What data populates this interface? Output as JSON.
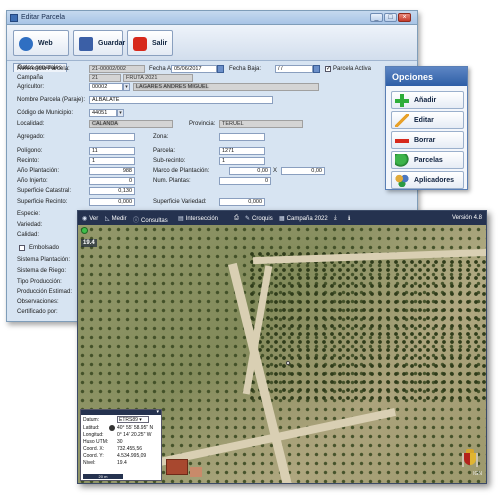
{
  "window": {
    "title": "Editar Parcela",
    "min": "_",
    "max": "□",
    "close": "×"
  },
  "toolbar": {
    "web": "Web",
    "guardar": "Guardar",
    "salir": "Salir"
  },
  "tab": "Datos generales",
  "form": {
    "referencia_label": "Referencia Parcela:",
    "referencia": "21-00002/002",
    "fecha_alta_label": "Fecha Alta:",
    "fecha_alta": "05/06/2017",
    "fecha_baja_label": "Fecha Baja:",
    "fecha_baja": " / /",
    "activa_label": "Parcela Activa",
    "activa_check": "✓",
    "campana_label": "Campaña",
    "campana_num": "21",
    "campana_name": "FRUTA 2021",
    "agricultor_label": "Agricultor:",
    "agricultor_code": "00002",
    "agricultor_name": "LAGARES ANDRES MIGUEL",
    "nombre_label": "Nombre Parcela (Paraje):",
    "nombre": "ALBALATE",
    "municipio_label": "Código de Municipio:",
    "municipio": "44051",
    "localidad_label": "Localidad:",
    "localidad": "CALANDA",
    "provincia_label": "Provincia:",
    "provincia": "TERUEL",
    "agregado_label": "Agregado:",
    "agregado": "",
    "zona_label": "Zona:",
    "zona": "",
    "poligono_label": "Polígono:",
    "poligono": "11",
    "parcela_label": "Parcela:",
    "parcela": "1271",
    "recinto_label": "Recinto:",
    "recinto": "1",
    "subrecinto_label": "Sub-recinto:",
    "subrecinto": "1",
    "ano_plantacion_label": "Año Plantación:",
    "ano_plantacion": "988",
    "marco_label": "Marco de Plantación:",
    "marco_a": "0,00",
    "marco_x": "X",
    "marco_b": "0,00",
    "ano_injerto_label": "Año Injerto:",
    "ano_injerto": "0",
    "num_plantas_label": "Num. Plantas:",
    "num_plantas": "0",
    "sup_catastral_label": "Superficie Catastral:",
    "sup_catastral": "0,130",
    "sup_recinto_label": "Superficie Recinto:",
    "sup_recinto": "0,000",
    "sup_variedad_label": "Superficie Variedad:",
    "sup_variedad": "0,000",
    "especie_label": "Especie:",
    "variedad_label": "Variedad:",
    "calidad_label": "Calidad:",
    "embolsado_label": "Embolsado",
    "sistema_plantacion_label": "Sistema Plantación:",
    "sistema_riego_label": "Sistema de Riego:",
    "tipo_produccion_label": "Tipo Producción:",
    "produccion_estimada_label": "Producción Estimad:",
    "observaciones_label": "Observaciones:",
    "certificado_label": "Certificado por:",
    "dropdown_arrow": "▾"
  },
  "opciones": {
    "title": "Opciones",
    "anadir": "Añadir",
    "editar": "Editar",
    "borrar": "Borrar",
    "parcelas": "Parcelas",
    "aplicadores": "Aplicadores"
  },
  "map": {
    "toolbar": {
      "ver": "Ver",
      "medir": "Medir",
      "consultas": "Consultas",
      "interseccion": "Intersección",
      "croquis": "Croquis",
      "campana": "Campaña 2022",
      "version": "Versión 4.8"
    },
    "zoom": "19.4",
    "coords": {
      "datum_label": "Datum:",
      "datum": "ETRS89 ▾",
      "lat_label": "Latitud:",
      "lat": "40° 55' 58.95\" N",
      "lon_label": "Longitud:",
      "lon": "0° 14' 20.25\" W",
      "huso_label": "Huso UTM:",
      "huso": "30",
      "x_label": "Coord. X:",
      "x": "732.455,56",
      "y_label": "Coord. Y:",
      "y": "4.534.995,09",
      "nivel_label": "Nivel:",
      "nivel": "19.4",
      "scale": "20 m"
    },
    "credit": "IGN"
  }
}
